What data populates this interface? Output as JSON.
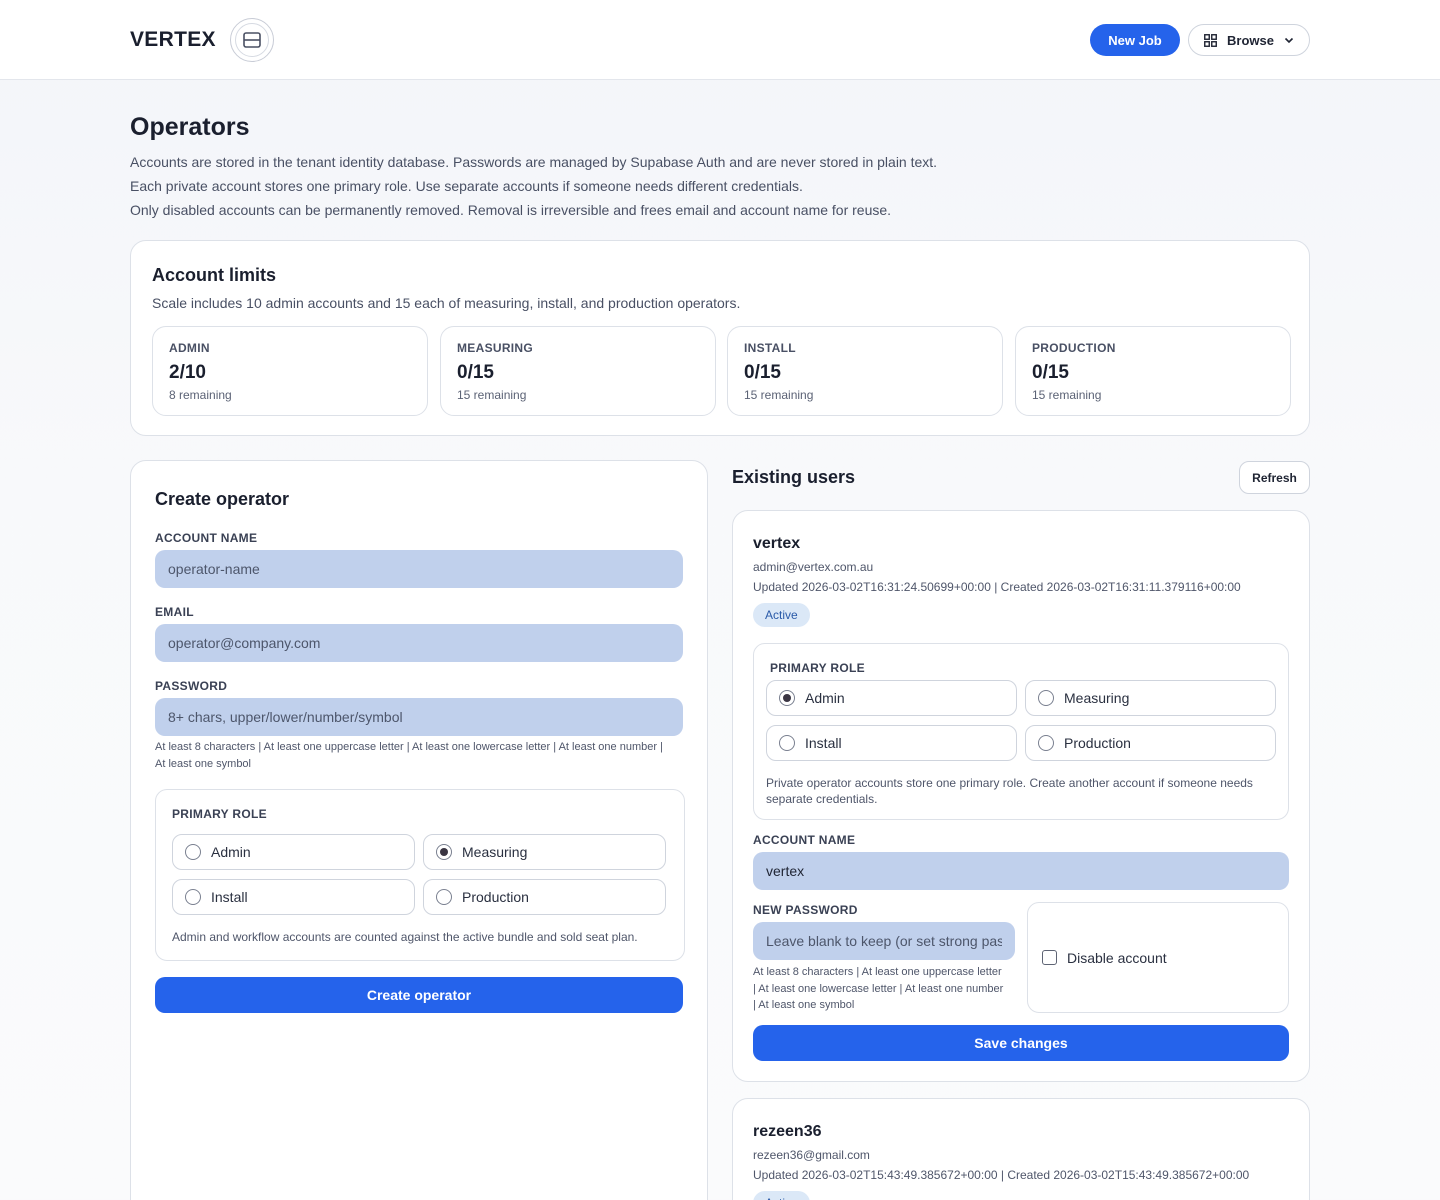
{
  "header": {
    "brand": "VERTEX",
    "new_job_label": "New Job",
    "browse_label": "Browse"
  },
  "page": {
    "title": "Operators",
    "intro": [
      "Accounts are stored in the tenant identity database. Passwords are managed by Supabase Auth and are never stored in plain text.",
      "Each private account stores one primary role. Use separate accounts if someone needs different credentials.",
      "Only disabled accounts can be permanently removed. Removal is irreversible and frees email and account name for reuse."
    ]
  },
  "limits": {
    "title": "Account limits",
    "subtitle": "Scale includes 10 admin accounts and 15 each of measuring, install, and production operators.",
    "items": [
      {
        "label": "ADMIN",
        "value": "2/10",
        "remaining": "8 remaining"
      },
      {
        "label": "MEASURING",
        "value": "0/15",
        "remaining": "15 remaining"
      },
      {
        "label": "INSTALL",
        "value": "0/15",
        "remaining": "15 remaining"
      },
      {
        "label": "PRODUCTION",
        "value": "0/15",
        "remaining": "15 remaining"
      }
    ]
  },
  "create": {
    "title": "Create operator",
    "account_name_label": "ACCOUNT NAME",
    "account_name_placeholder": "operator-name",
    "email_label": "EMAIL",
    "email_placeholder": "operator@company.com",
    "password_label": "PASSWORD",
    "password_placeholder": "8+ chars, upper/lower/number/symbol",
    "password_hint_1": "At least 8 characters | At least one uppercase letter | At least one lowercase letter | At least one number |",
    "password_hint_2": "At least one symbol",
    "role_label": "PRIMARY ROLE",
    "roles": [
      "Admin",
      "Measuring",
      "Install",
      "Production"
    ],
    "selected_role": "Measuring",
    "role_note": "Admin and workflow accounts are counted against the active bundle and sold seat plan.",
    "submit_label": "Create operator"
  },
  "existing": {
    "title": "Existing users",
    "refresh_label": "Refresh",
    "users": [
      {
        "name": "vertex",
        "email": "admin@vertex.com.au",
        "meta": "Updated 2026-03-02T16:31:24.50699+00:00 | Created 2026-03-02T16:31:11.379116+00:00",
        "status": "Active",
        "role_label": "PRIMARY ROLE",
        "roles": [
          "Admin",
          "Measuring",
          "Install",
          "Production"
        ],
        "selected_role": "Admin",
        "role_note_1": "Private operator accounts store one primary role. Create another account if someone needs",
        "role_note_2": "separate credentials.",
        "account_name_label": "ACCOUNT NAME",
        "account_name_value": "vertex",
        "new_password_label": "NEW PASSWORD",
        "new_password_placeholder": "Leave blank to keep (or set strong password)",
        "password_hint_1": "At least 8 characters | At least one uppercase letter",
        "password_hint_2": "| At least one lowercase letter | At least one number",
        "password_hint_3": "| At least one symbol",
        "disable_label": "Disable account",
        "save_label": "Save changes"
      },
      {
        "name": "rezeen36",
        "email": "rezeen36@gmail.com",
        "meta": "Updated 2026-03-02T15:43:49.385672+00:00 | Created 2026-03-02T15:43:49.385672+00:00",
        "status": "Active"
      }
    ]
  },
  "colors": {
    "accent": "#2563eb",
    "input_bg": "#c0d0ec",
    "badge_bg": "#dbe8f7"
  },
  "icons": [
    "logo-emblem-icon",
    "grid-icon",
    "chevron-down-icon",
    "radio-icon",
    "checkbox-icon"
  ]
}
